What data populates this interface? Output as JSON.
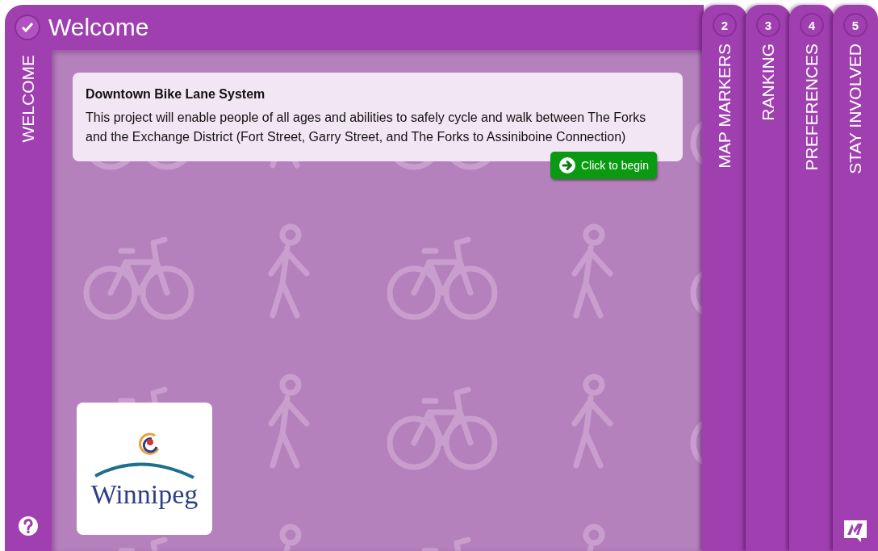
{
  "active_step": {
    "title": "Welcome",
    "label": "WELCOME",
    "completed": true
  },
  "intro": {
    "title": "Downtown Bike Lane System",
    "text": "This project will enable people of all ages and abilities to safely cycle and walk between The Forks and the Exchange District (Fort Street, Garry Street, and The Forks to Assiniboine Connection)",
    "button": "Click to begin"
  },
  "logo": {
    "text": "Winnipeg"
  },
  "steps": [
    {
      "number": "2",
      "label": "MAP MARKERS",
      "selected": false
    },
    {
      "number": "3",
      "label": "RANKING",
      "selected": false
    },
    {
      "number": "4",
      "label": "PREFERENCES",
      "selected": false
    },
    {
      "number": "5",
      "label": "STAY INVOLVED",
      "selected": false
    }
  ]
}
